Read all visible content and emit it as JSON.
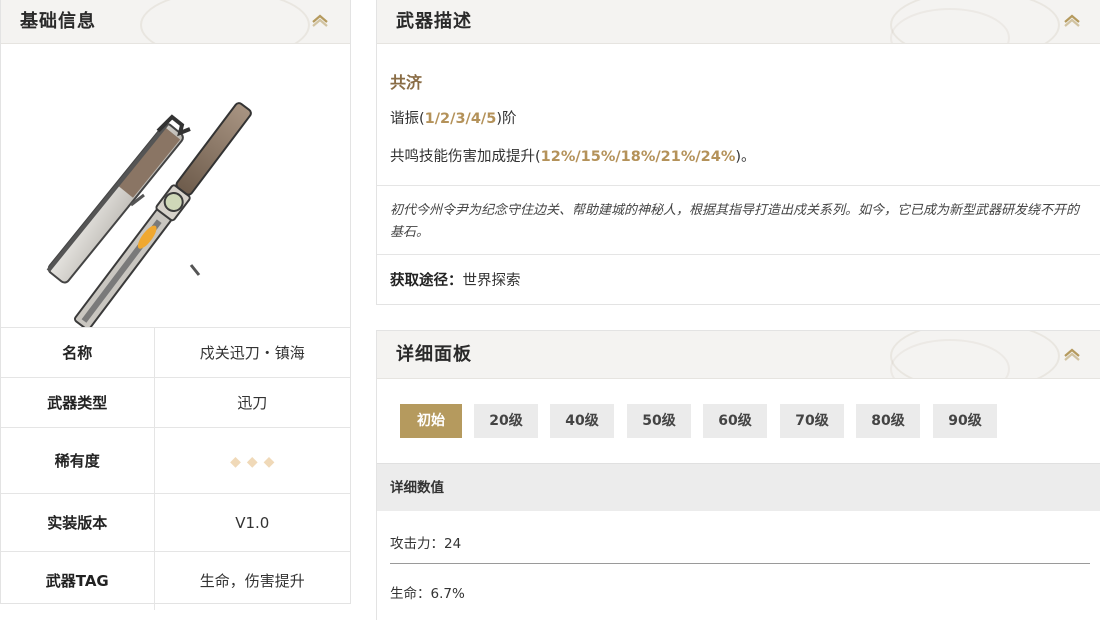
{
  "basic": {
    "title": "基础信息",
    "rows": [
      {
        "label": "名称",
        "value": "戍关迅刀・镇海"
      },
      {
        "label": "武器类型",
        "value": "迅刀"
      },
      {
        "label": "稀有度",
        "stars": 3
      },
      {
        "label": "实装版本",
        "value": "V1.0"
      },
      {
        "label": "武器TAG",
        "value": "生命，伤害提升"
      }
    ]
  },
  "desc": {
    "title": "武器描述",
    "skill_name": "共济",
    "resonance_prefix": "谐振(",
    "resonance_levels": "1/2/3/4/5",
    "resonance_suffix": ")阶",
    "effect_prefix": "共鸣技能伤害加成提升(",
    "effect_values": "12%/15%/18%/21%/24%",
    "effect_suffix": ")。",
    "lore": "初代今州令尹为纪念守住边关、帮助建城的神秘人，根据其指导打造出戍关系列。如今，它已成为新型武器研发绕不开的基石。",
    "source_label": "获取途径：",
    "source_value": "世界探索"
  },
  "detail": {
    "title": "详细面板",
    "tabs": [
      "初始",
      "20级",
      "40级",
      "50级",
      "60级",
      "70级",
      "80级",
      "90级"
    ],
    "active_tab": 0,
    "stats_header": "详细数值",
    "stats": [
      "攻击力：24",
      "生命：6.7%"
    ]
  },
  "colors": {
    "accent": "#b59a5e",
    "gold_text": "#b4925a",
    "skill_name": "#8a6d46",
    "chevron": "#b59a5e"
  }
}
